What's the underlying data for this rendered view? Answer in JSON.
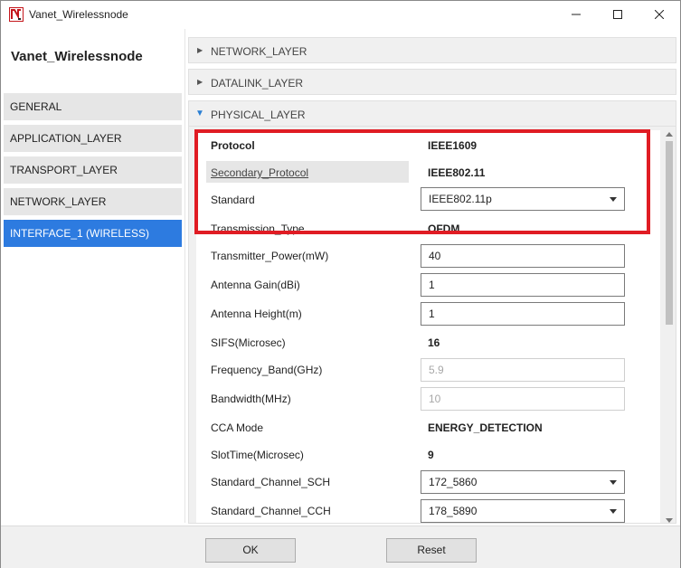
{
  "window": {
    "title": "Vanet_Wirelessnode",
    "minimize_icon": "minimize-icon",
    "maximize_icon": "maximize-icon",
    "close_icon": "close-icon"
  },
  "sidebar": {
    "title": "Vanet_Wirelessnode",
    "items": [
      {
        "label": "GENERAL",
        "active": false
      },
      {
        "label": "APPLICATION_LAYER",
        "active": false
      },
      {
        "label": "TRANSPORT_LAYER",
        "active": false
      },
      {
        "label": "NETWORK_LAYER",
        "active": false
      },
      {
        "label": "INTERFACE_1 (WIRELESS)",
        "active": true
      }
    ]
  },
  "sections": {
    "network": {
      "label": "NETWORK_LAYER",
      "expanded": false
    },
    "datalink": {
      "label": "DATALINK_LAYER",
      "expanded": false
    },
    "physical": {
      "label": "PHYSICAL_LAYER",
      "expanded": true
    }
  },
  "physical": {
    "protocol": {
      "label": "Protocol",
      "value": "IEEE1609"
    },
    "secondary_protocol": {
      "label": "Secondary_Protocol",
      "value": "IEEE802.11"
    },
    "standard": {
      "label": "Standard",
      "value": "IEEE802.11p"
    },
    "transmission_type": {
      "label": "Transmission_Type",
      "value": "OFDM"
    },
    "transmitter_power": {
      "label": "Transmitter_Power(mW)",
      "value": "40"
    },
    "antenna_gain": {
      "label": "Antenna Gain(dBi)",
      "value": "1"
    },
    "antenna_height": {
      "label": "Antenna Height(m)",
      "value": "1"
    },
    "sifs": {
      "label": "SIFS(Microsec)",
      "value": "16"
    },
    "frequency_band": {
      "label": "Frequency_Band(GHz)",
      "value": "5.9"
    },
    "bandwidth": {
      "label": "Bandwidth(MHz)",
      "value": "10"
    },
    "cca_mode": {
      "label": "CCA Mode",
      "value": "ENERGY_DETECTION"
    },
    "slot_time": {
      "label": "SlotTime(Microsec)",
      "value": "9"
    },
    "channel_sch": {
      "label": "Standard_Channel_SCH",
      "value": "172_5860"
    },
    "channel_cch": {
      "label": "Standard_Channel_CCH",
      "value": "178_5890"
    }
  },
  "footer": {
    "ok_label": "OK",
    "reset_label": "Reset"
  },
  "colors": {
    "accent": "#2d7be0",
    "highlight_border": "#e01c24"
  }
}
